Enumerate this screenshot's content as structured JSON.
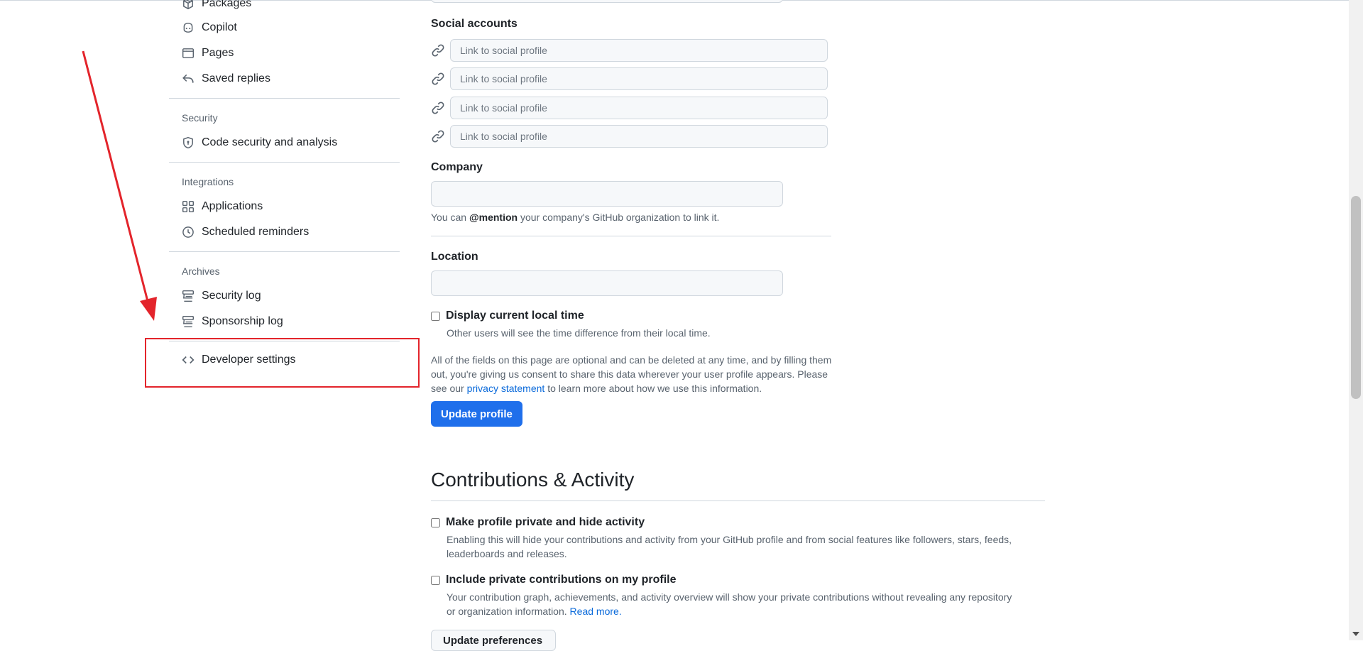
{
  "sidebar": {
    "items_top": [
      {
        "label": "Packages",
        "icon": "package-icon"
      },
      {
        "label": "Copilot",
        "icon": "copilot-icon"
      },
      {
        "label": "Pages",
        "icon": "browser-icon"
      },
      {
        "label": "Saved replies",
        "icon": "reply-icon"
      }
    ],
    "security": {
      "title": "Security",
      "items": [
        {
          "label": "Code security and analysis",
          "icon": "shield-lock-icon"
        }
      ]
    },
    "integrations": {
      "title": "Integrations",
      "items": [
        {
          "label": "Applications",
          "icon": "apps-icon"
        },
        {
          "label": "Scheduled reminders",
          "icon": "clock-icon"
        }
      ]
    },
    "archives": {
      "title": "Archives",
      "items": [
        {
          "label": "Security log",
          "icon": "log-icon"
        },
        {
          "label": "Sponsorship log",
          "icon": "log-icon"
        }
      ]
    },
    "developer": {
      "label": "Developer settings",
      "icon": "code-icon"
    }
  },
  "profile": {
    "social": {
      "label": "Social accounts",
      "placeholder": "Link to social profile",
      "rows": [
        "",
        "",
        "",
        ""
      ]
    },
    "company": {
      "label": "Company",
      "value": "",
      "note_prefix": "You can ",
      "note_bold": "@mention",
      "note_suffix": " your company's GitHub organization to link it."
    },
    "location": {
      "label": "Location",
      "value": ""
    },
    "local_time": {
      "label": "Display current local time",
      "description": "Other users will see the time difference from their local time.",
      "checked": false
    },
    "consent": {
      "text_before": "All of the fields on this page are optional and can be deleted at any time, and by filling them out, you're giving us consent to share this data wherever your user profile appears. Please see our ",
      "link": "privacy statement",
      "text_after": " to learn more about how we use this information."
    },
    "update_button": "Update profile"
  },
  "contributions": {
    "heading": "Contributions & Activity",
    "private": {
      "label": "Make profile private and hide activity",
      "description": "Enabling this will hide your contributions and activity from your GitHub profile and from social features like followers, stars, feeds, leaderboards and releases.",
      "checked": false
    },
    "include_private": {
      "label": "Include private contributions on my profile",
      "description": "Your contribution graph, achievements, and activity overview will show your private contributions without revealing any repository or organization information.",
      "link": "Read more.",
      "checked": false
    },
    "update_button": "Update preferences"
  },
  "annotation": {
    "color": "#e3242b"
  }
}
